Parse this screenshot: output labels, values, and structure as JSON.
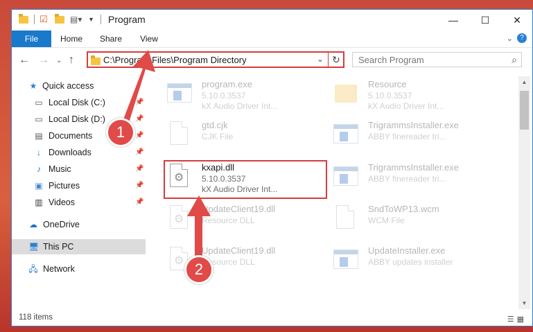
{
  "window": {
    "title": "Program",
    "controls": {
      "minimize": "—",
      "maximize": "☐",
      "close": "✕"
    }
  },
  "ribbon": {
    "tabs": [
      "File",
      "Home",
      "Share",
      "View"
    ]
  },
  "address": {
    "path": "C:\\Program Files\\Program Directory"
  },
  "search": {
    "placeholder": "Search Program"
  },
  "nav": {
    "items": [
      {
        "label": "Quick access",
        "icon": "star-icon"
      },
      {
        "label": "Local Disk (C:)",
        "icon": "drive-icon",
        "pinned": true
      },
      {
        "label": "Local Disk (D:)",
        "icon": "drive-icon",
        "pinned": true
      },
      {
        "label": "Documents",
        "icon": "documents-icon",
        "pinned": true
      },
      {
        "label": "Downloads",
        "icon": "download-icon",
        "pinned": true
      },
      {
        "label": "Music",
        "icon": "music-icon",
        "pinned": true
      },
      {
        "label": "Pictures",
        "icon": "pictures-icon",
        "pinned": true
      },
      {
        "label": "Videos",
        "icon": "videos-icon",
        "pinned": true
      },
      {
        "label": "OneDrive",
        "icon": "cloud-icon"
      },
      {
        "label": "This PC",
        "icon": "computer-icon",
        "selected": true
      },
      {
        "label": "Network",
        "icon": "network-icon"
      }
    ]
  },
  "files": [
    {
      "name": "program.exe",
      "line1": "5.10.0.3537",
      "line2": "kX Audio Driver Int...",
      "icon": "exe-icon"
    },
    {
      "name": "Resource",
      "line1": "5.10.0.3537",
      "line2": "kX Audio Driver Int...",
      "icon": "folder-icon"
    },
    {
      "name": "gtd.cjk",
      "line1": "CJK File",
      "line2": "",
      "icon": "file-icon"
    },
    {
      "name": "TrigrammsInstaller.exe",
      "line1": "ABBY finereader tri...",
      "line2": "",
      "icon": "app-icon"
    },
    {
      "name": "kxapi.dll",
      "line1": "5.10.0.3537",
      "line2": "kX Audio Driver Int...",
      "icon": "dll-icon",
      "highlighted": true
    },
    {
      "name": "TrigrammsInstaller.exe",
      "line1": "ABBY finereader tri...",
      "line2": "",
      "icon": "app-icon"
    },
    {
      "name": "UpdateClient19.dll",
      "line1": "Resource DLL",
      "line2": "",
      "icon": "dll-icon"
    },
    {
      "name": "SndToWP13.wcm",
      "line1": "WCM File",
      "line2": "",
      "icon": "file-icon"
    },
    {
      "name": "UpdateClient19.dll",
      "line1": "Resource DLL",
      "line2": "",
      "icon": "dll-icon"
    },
    {
      "name": "UpdateInstaller.exe",
      "line1": "ABBY updates installer",
      "line2": "",
      "icon": "app-icon"
    }
  ],
  "status": {
    "count": "118 items"
  },
  "callouts": [
    {
      "number": "1"
    },
    {
      "number": "2"
    }
  ]
}
